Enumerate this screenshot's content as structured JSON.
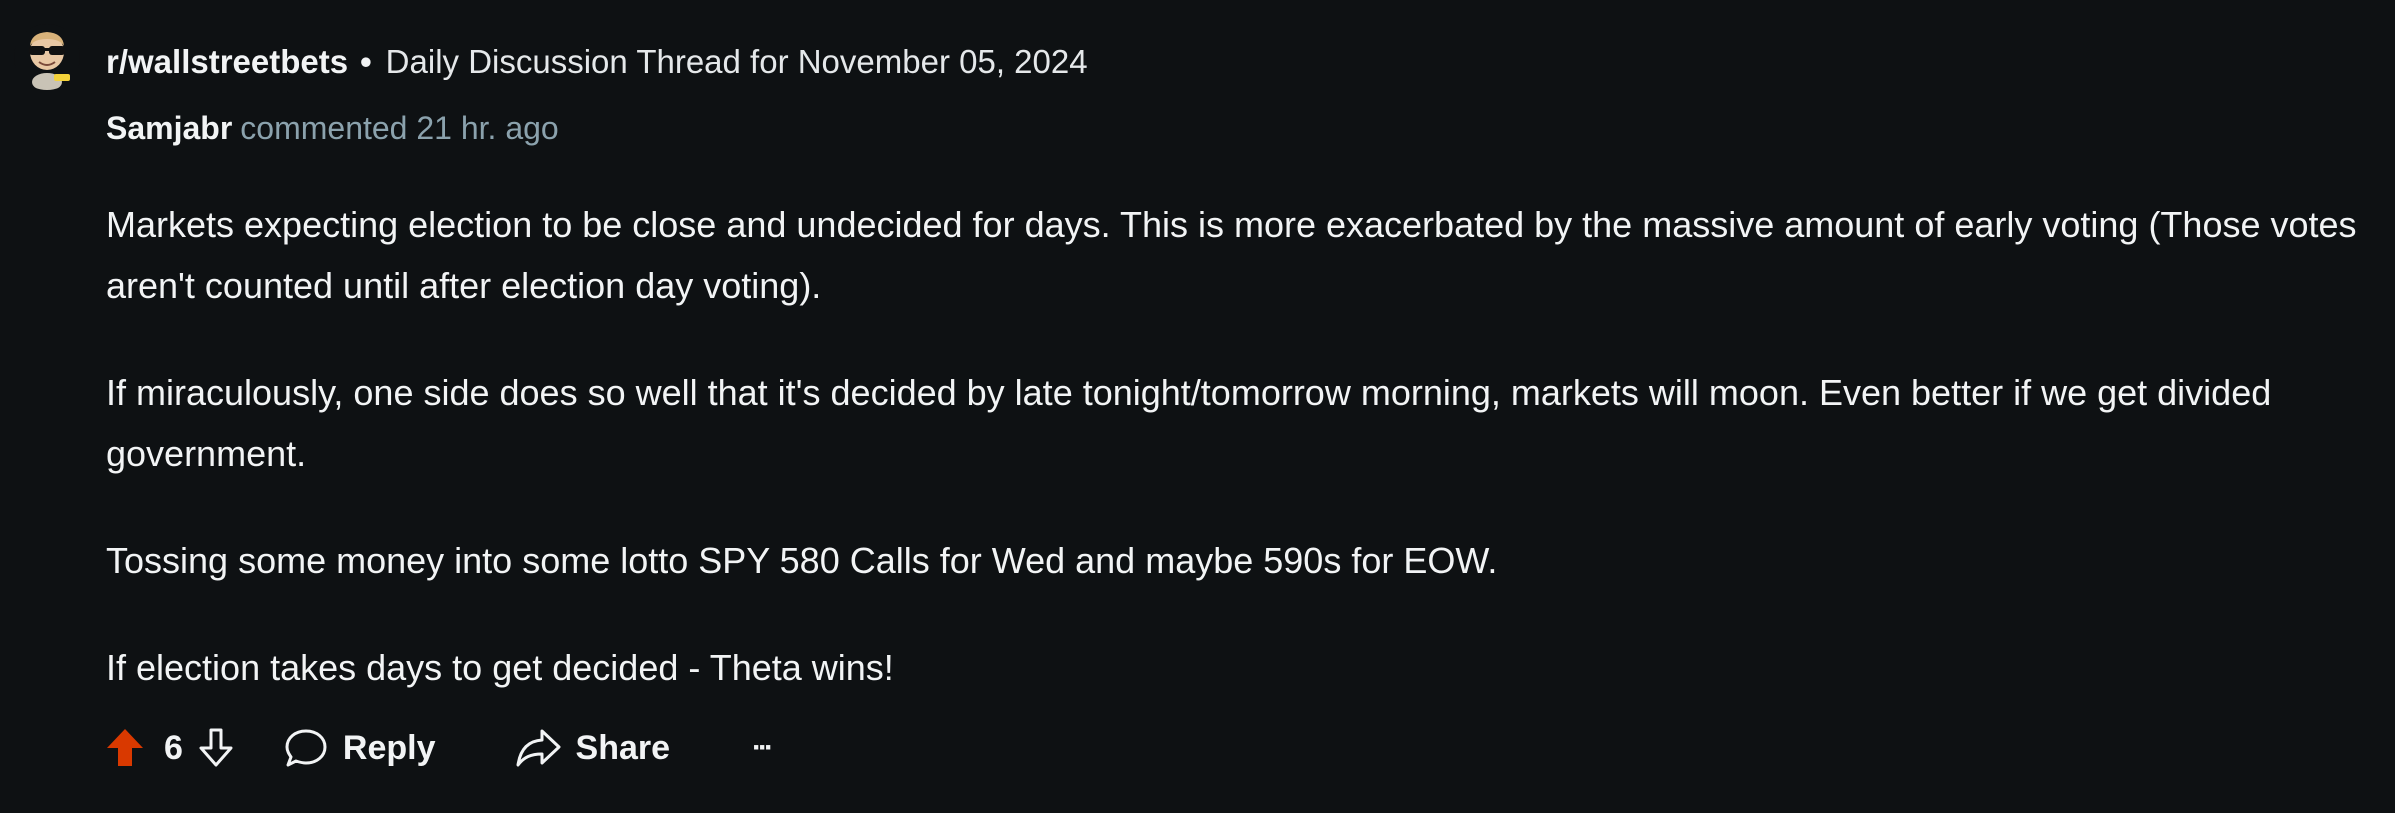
{
  "header": {
    "subreddit": "r/wallstreetbets",
    "separator": "•",
    "thread_title": "Daily Discussion Thread for November 05, 2024"
  },
  "comment": {
    "author": "Samjabr",
    "meta": "commented 21 hr. ago",
    "paragraphs": [
      "Markets expecting election to be close and undecided for days. This is more exacerbated by the massive amount of early voting (Those votes aren't counted until after election day voting).",
      "If miraculously, one side does so well that it's decided by late tonight/tomorrow morning, markets will moon. Even better if we get divided government.",
      "Tossing some money into some lotto SPY 580 Calls for Wed and maybe 590s for EOW.",
      "If election takes days to get decided - Theta wins!"
    ]
  },
  "actions": {
    "score": "6",
    "reply_label": "Reply",
    "share_label": "Share",
    "more_label": "···"
  },
  "icons": {
    "upvote": "upvote-arrow-icon",
    "downvote": "downvote-arrow-icon",
    "reply": "speech-bubble-icon",
    "share": "share-arrow-icon",
    "more": "ellipsis-icon",
    "avatar": "snoo-sunglasses-avatar"
  },
  "colors": {
    "background": "#0e1113",
    "upvote_active": "#d93900",
    "meta_text": "#8ba2ad"
  }
}
